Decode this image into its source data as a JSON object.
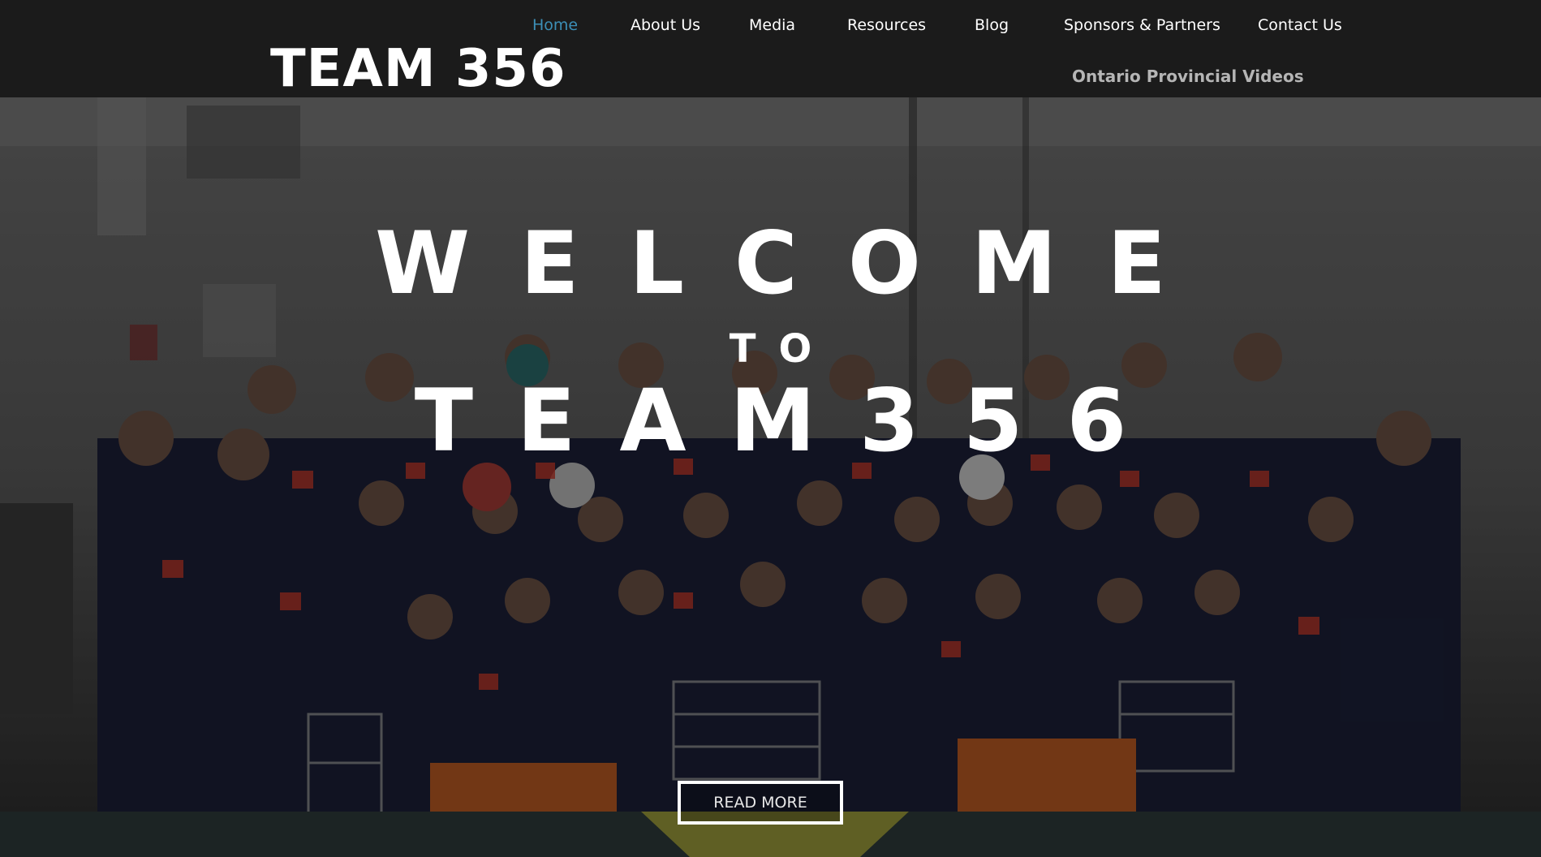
{
  "header": {
    "brand": "TEAM 356",
    "nav": [
      {
        "label": "Home",
        "active": true
      },
      {
        "label": "About Us",
        "active": false
      },
      {
        "label": "Media",
        "active": false
      },
      {
        "label": "Resources",
        "active": false
      },
      {
        "label": "Blog",
        "active": false
      },
      {
        "label": "Sponsors & Partners",
        "active": false
      },
      {
        "label": "Contact Us",
        "active": false
      }
    ],
    "subnav_label": "Ontario Provincial Videos"
  },
  "hero": {
    "line1": "WELCOME",
    "line2": "TO",
    "line3": "TEAM356",
    "button_label": "READ MORE",
    "background": "team-group-photo"
  },
  "colors": {
    "header_bg": "#1b1b1b",
    "nav_text": "#ffffff",
    "nav_active": "#3c8fb7",
    "subnav_text": "#b5b5b5",
    "hero_text": "#ffffff"
  }
}
